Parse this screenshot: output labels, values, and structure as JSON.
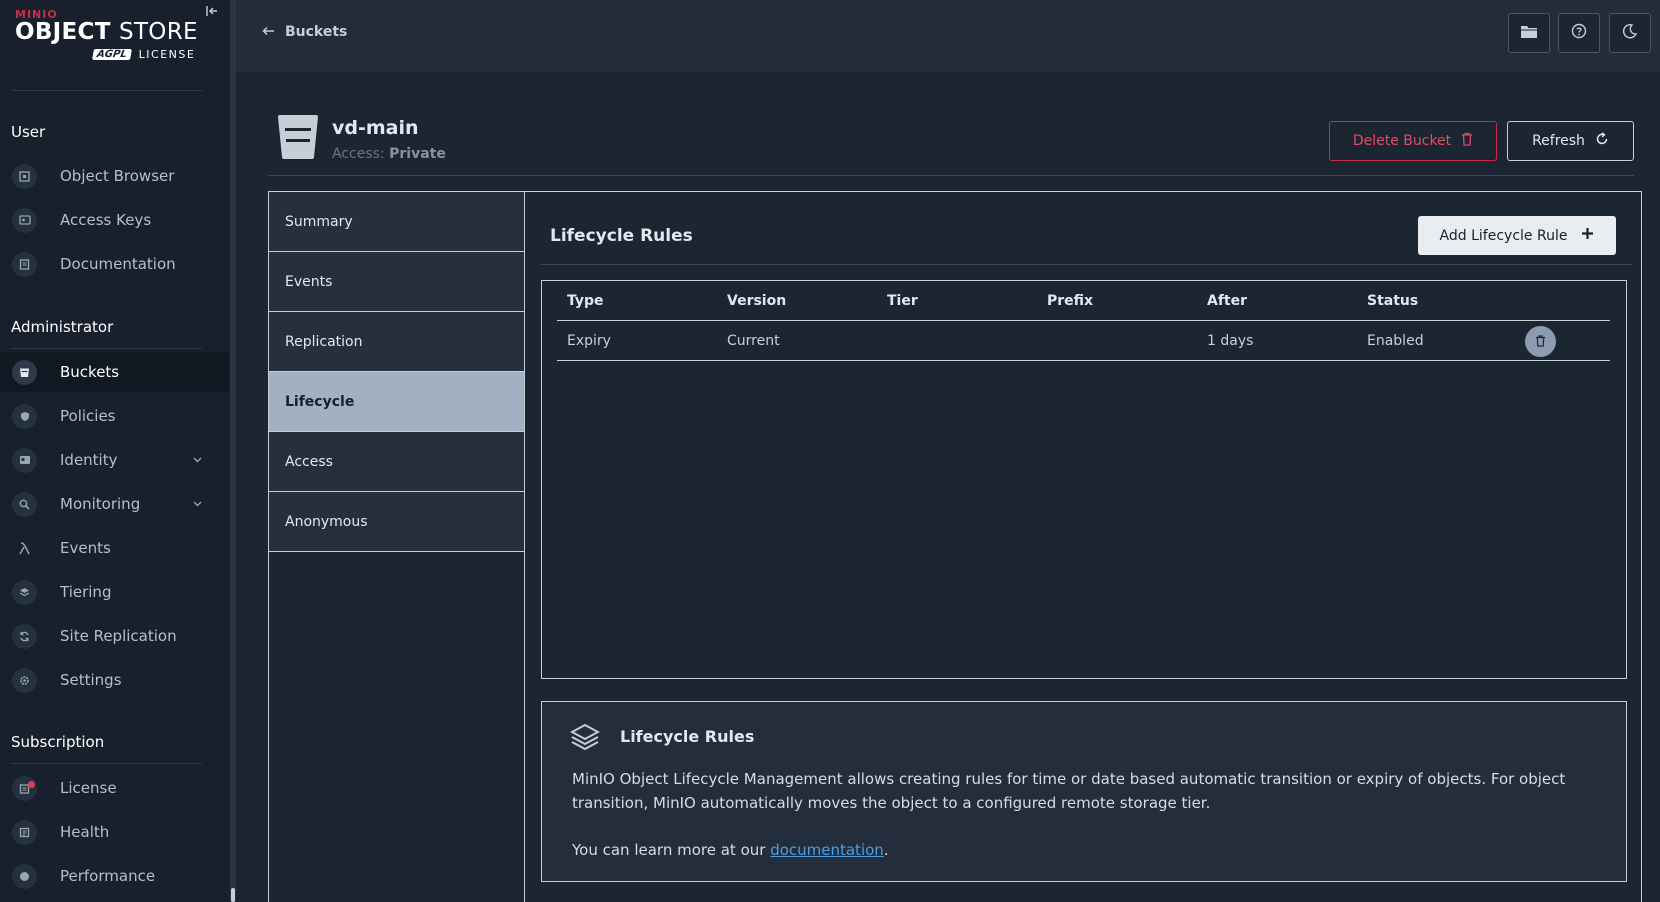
{
  "sidebar": {
    "logo_brand": "MINIO",
    "logo_title_bold": "OBJECT",
    "logo_title_thin": "STORE",
    "logo_agpl": "AGPL",
    "logo_license": "LICENSE",
    "sections": {
      "user": "User",
      "administrator": "Administrator",
      "subscription": "Subscription"
    },
    "user_items": [
      {
        "label": "Object Browser",
        "icon": "object-browser-icon"
      },
      {
        "label": "Access Keys",
        "icon": "access-keys-icon"
      },
      {
        "label": "Documentation",
        "icon": "documentation-icon"
      }
    ],
    "admin_items": [
      {
        "label": "Buckets",
        "icon": "bucket-icon",
        "active": true
      },
      {
        "label": "Policies",
        "icon": "policies-icon"
      },
      {
        "label": "Identity",
        "icon": "identity-icon",
        "expandable": true
      },
      {
        "label": "Monitoring",
        "icon": "monitoring-icon",
        "expandable": true
      },
      {
        "label": "Events",
        "icon": "lambda-icon"
      },
      {
        "label": "Tiering",
        "icon": "tiering-icon"
      },
      {
        "label": "Site Replication",
        "icon": "site-replication-icon"
      },
      {
        "label": "Settings",
        "icon": "settings-icon"
      }
    ],
    "subscription_items": [
      {
        "label": "License",
        "icon": "license-icon"
      },
      {
        "label": "Health",
        "icon": "health-icon"
      },
      {
        "label": "Performance",
        "icon": "performance-icon"
      }
    ]
  },
  "topbar": {
    "back_label": "Buckets",
    "buttons": [
      "folder-icon",
      "help-icon",
      "dark-mode-icon"
    ]
  },
  "bucket": {
    "name": "vd-main",
    "access_label": "Access:",
    "access_value": "Private",
    "delete_label": "Delete Bucket",
    "refresh_label": "Refresh"
  },
  "tabs": [
    "Summary",
    "Events",
    "Replication",
    "Lifecycle",
    "Access",
    "Anonymous"
  ],
  "active_tab": "Lifecycle",
  "lifecycle": {
    "title": "Lifecycle Rules",
    "add_label": "Add Lifecycle Rule",
    "columns": [
      "Type",
      "Version",
      "Tier",
      "Prefix",
      "After",
      "Status"
    ],
    "rows": [
      {
        "type": "Expiry",
        "version": "Current",
        "tier": "",
        "prefix": "",
        "after": "1 days",
        "status": "Enabled"
      }
    ]
  },
  "help": {
    "title": "Lifecycle Rules",
    "text": "MinIO Object Lifecycle Management allows creating rules for time or date based automatic transition or expiry of objects. For object transition, MinIO automatically moves the object to a configured remote storage tier.",
    "more_prefix": "You can learn more at our ",
    "more_link": "documentation",
    "more_suffix": "."
  },
  "colors": {
    "accent_red": "#c72c48",
    "active_tab_bg": "#a3b0c2",
    "link": "#4d9de0"
  }
}
